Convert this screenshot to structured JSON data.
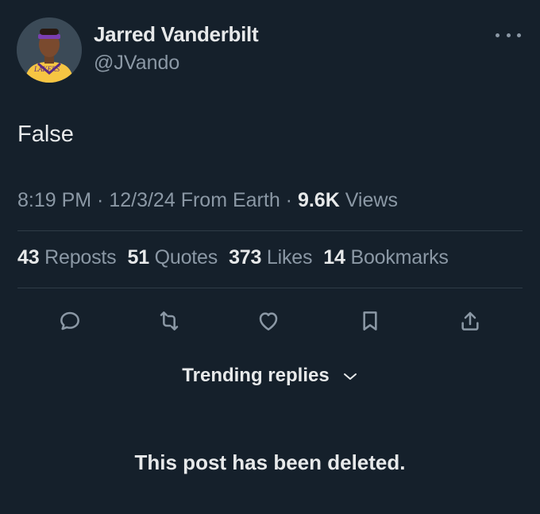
{
  "author": {
    "display_name": "Jarred Vanderbilt",
    "handle": "@JVando",
    "avatar_jersey_text": "LAKERS"
  },
  "post": {
    "text": "False",
    "time": "8:19 PM",
    "sep1": " · ",
    "date": "12/3/24",
    "location": " From Earth",
    "sep2": " · ",
    "views_count": "9.6K",
    "views_label": " Views"
  },
  "stats": {
    "reposts": {
      "count": "43",
      "label": " Reposts"
    },
    "quotes": {
      "count": "51",
      "label": " Quotes"
    },
    "likes": {
      "count": "373",
      "label": " Likes"
    },
    "bookmarks": {
      "count": "14",
      "label": " Bookmarks"
    }
  },
  "actions": [
    "reply-icon",
    "repost-icon",
    "like-icon",
    "bookmark-icon",
    "share-icon"
  ],
  "replies": {
    "sort_label": "Trending replies"
  },
  "notice": {
    "deleted_text": "This post has been deleted."
  },
  "colors": {
    "background": "#15202b",
    "primary_text": "#e7e9ea",
    "secondary_text": "#8b98a5",
    "divider": "#2f3b47"
  }
}
